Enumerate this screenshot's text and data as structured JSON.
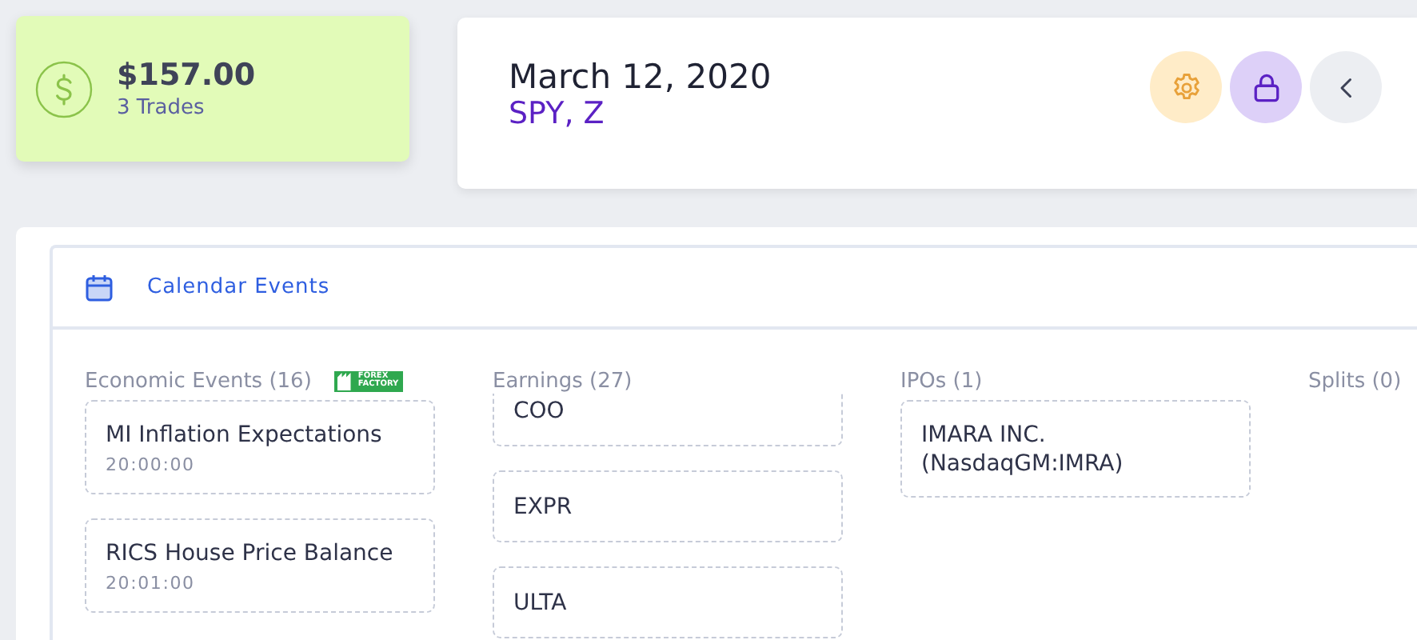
{
  "summary": {
    "amount": "$157.00",
    "trades": "3 Trades"
  },
  "header": {
    "date": "March 12, 2020",
    "symbols": "SPY, Z"
  },
  "actions": [
    {
      "kind": "settings"
    },
    {
      "kind": "lock"
    },
    {
      "kind": "back"
    }
  ],
  "calendar": {
    "title": "Calendar Events",
    "columns": [
      {
        "kind": "economic",
        "heading": "Economic Events (16)",
        "logo": "FOREX FACTORY",
        "items": [
          {
            "title": "MI Inflation Expectations",
            "time": "20:00:00"
          },
          {
            "title": "RICS House Price Balance",
            "time": "20:01:00"
          }
        ]
      },
      {
        "kind": "earnings",
        "heading": "Earnings (27)",
        "items": [
          {
            "title": "COO"
          },
          {
            "title": "EXPR"
          },
          {
            "title": "ULTA"
          }
        ]
      },
      {
        "kind": "ipo",
        "heading": "IPOs (1)",
        "items": [
          {
            "title": "IMARA INC. (NasdaqGM:IMRA)"
          }
        ]
      },
      {
        "kind": "splits",
        "heading": "Splits (0)"
      }
    ]
  }
}
